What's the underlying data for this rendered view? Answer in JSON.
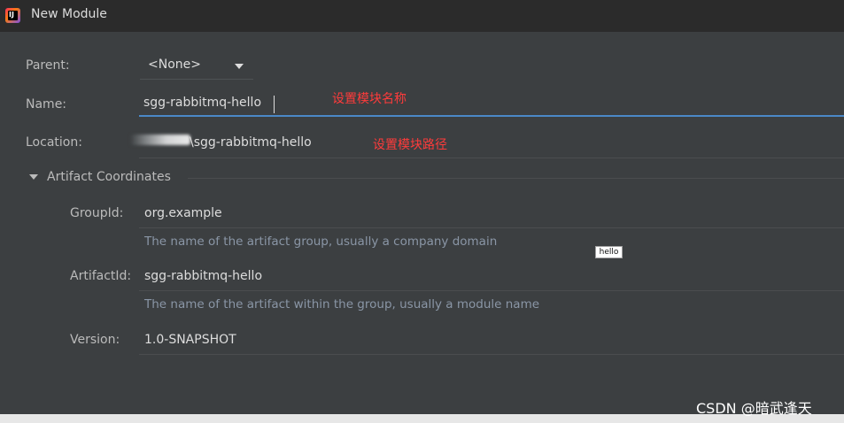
{
  "window": {
    "title": "New Module",
    "icon": "intellij-idea-icon"
  },
  "form": {
    "parent": {
      "label": "Parent:",
      "value": "<None>"
    },
    "name": {
      "label": "Name:",
      "value": "sgg-rabbitmq-hello",
      "annotation": "设置模块名称"
    },
    "location": {
      "label": "Location:",
      "value": "\\sgg-rabbitmq-hello",
      "annotation": "设置模块路径"
    }
  },
  "artifact": {
    "section_title": "Artifact Coordinates",
    "group_id": {
      "label": "GroupId:",
      "value": "org.example",
      "hint": "The name of the artifact group, usually a company domain"
    },
    "artifact_id": {
      "label": "ArtifactId:",
      "value": "sgg-rabbitmq-hello",
      "hint": "The name of the artifact within the group, usually a module name"
    },
    "version": {
      "label": "Version:",
      "value": "1.0-SNAPSHOT"
    }
  },
  "tooltip": {
    "text": "hello"
  },
  "watermark": {
    "text": "CSDN @暗武逢天"
  },
  "colors": {
    "background": "#3c3f41",
    "titlebar": "#2b2b2b",
    "focus_underline": "#4a88c7",
    "annotation": "#ff3b3b",
    "hint": "#8a96a6"
  }
}
